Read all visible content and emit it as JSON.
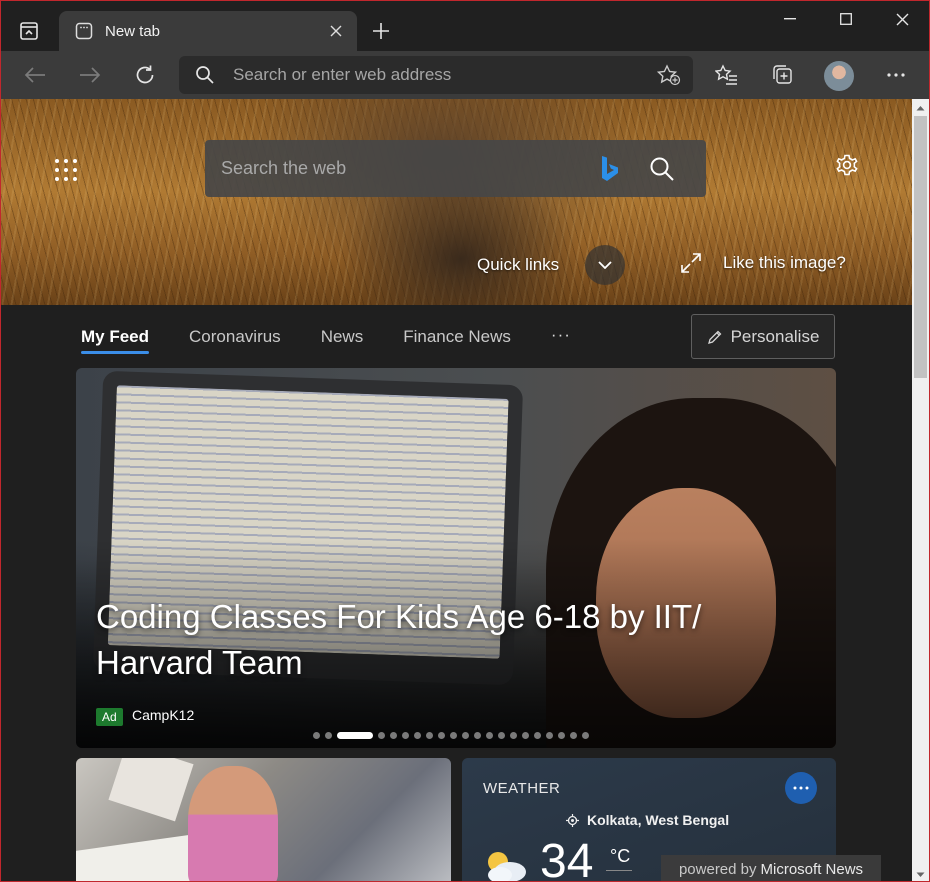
{
  "browser": {
    "tab_title": "New tab",
    "address_placeholder": "Search or enter web address"
  },
  "hero": {
    "search_placeholder": "Search the web",
    "quick_links_label": "Quick links",
    "like_image_label": "Like this image?"
  },
  "feed": {
    "tabs": [
      {
        "label": "My Feed",
        "active": true
      },
      {
        "label": "Coronavirus",
        "active": false
      },
      {
        "label": "News",
        "active": false
      },
      {
        "label": "Finance News",
        "active": false
      }
    ],
    "more_label": "···",
    "personalise_label": "Personalise"
  },
  "main_card": {
    "title": "Coding Classes For Kids Age 6-18 by IIT/ Harvard Team",
    "ad_badge": "Ad",
    "source": "CampK12",
    "carousel_total": 21,
    "carousel_active": 3
  },
  "weather": {
    "title": "WEATHER",
    "location": "Kolkata, West Bengal",
    "temperature": "34",
    "unit": "°C",
    "more_label": "···"
  },
  "footer": {
    "powered_prefix": "powered by",
    "powered_brand": "Microsoft News"
  },
  "colors": {
    "accent": "#3b8ee8",
    "window_border": "#c1272d",
    "ad_green": "#1d7a2e",
    "weather_more": "#1f5fb0"
  }
}
